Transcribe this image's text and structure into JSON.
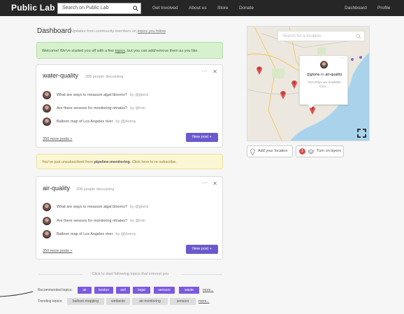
{
  "nav": {
    "logo": "Public Lab",
    "search_placeholder": "Search on Public Lab",
    "links": [
      "Get Involved",
      "About us",
      "Store",
      "Donate"
    ],
    "right_links": [
      "Dashboard",
      "Profile"
    ]
  },
  "dashboard": {
    "title": "Dashboard",
    "subtitle_prefix": "Updates from community members on",
    "subtitle_link": "topics you follow"
  },
  "welcome_alert": {
    "prefix": "Welcome! We've started you off with a few",
    "link": "topics",
    "suffix": ", but you can add/remove them as you like."
  },
  "cards": [
    {
      "topic": "water-quality",
      "count": "208 people discussing",
      "posts": [
        {
          "title": "What are ways to measure algal blooms?",
          "author": "by @gloria"
        },
        {
          "title": "Are there sensors for monitoring nitrates?",
          "author": "by @min"
        },
        {
          "title": "Balloon map of Los Angeles river",
          "author": "by @jhonny"
        }
      ],
      "more": "350 more posts »",
      "new_post": "New post +"
    },
    {
      "topic": "air-quality",
      "count": "208 people discussing",
      "posts": [
        {
          "title": "What are ways to measure algal blooms?",
          "author": "by @gloria"
        },
        {
          "title": "Are there sensors for monitoring nitrates?",
          "author": "by @min"
        },
        {
          "title": "Balloon map of Los Angeles river",
          "author": "by @jhonny"
        }
      ],
      "more": "350 more posts »",
      "new_post": "New post +"
    }
  ],
  "unsub_alert": {
    "prefix": "You've just unsubscribed from",
    "topic": "pipeline-monitoring",
    "suffix": ". Click here to re-subscribe."
  },
  "follow_hint": "Click to start following topics that interest you",
  "recommended": {
    "label": "Recommended topics:",
    "tags": [
      "air",
      "boston",
      "soil",
      "legal",
      "sensors",
      "waste"
    ],
    "more": "more..."
  },
  "trending": {
    "label": "Trending topics:",
    "tags": [
      "balloon-mapping",
      "wetlands",
      "air-monitoring",
      "sensors"
    ],
    "more": "more..."
  },
  "map": {
    "search_placeholder": "Search for a location",
    "popup_user": "@gloria",
    "popup_on": "on",
    "popup_topic": "air-quality",
    "popup_desc": "Test strips are available from ...",
    "add_location": "Add your location",
    "layers_badge": "1",
    "layers_label": "Turn on layers"
  },
  "colors": {
    "accent": "#6a5acd",
    "tag": "#7b5ae0",
    "water": "#a9d3ea",
    "marker": "#d9534f"
  }
}
